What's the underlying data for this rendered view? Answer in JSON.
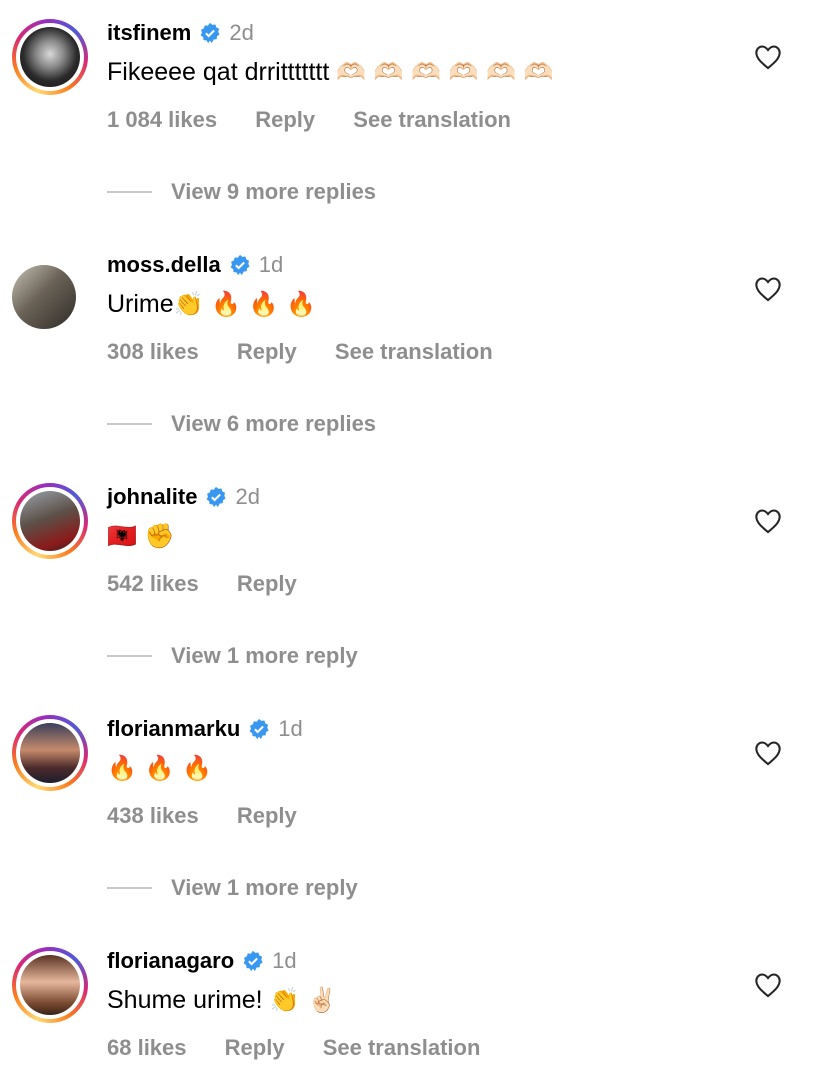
{
  "comments": [
    {
      "username": "itsfinem",
      "time": "2d",
      "text": "Fikeeee qat drrittttttt ",
      "emoji": "🫶🏻 🫶🏻 🫶🏻 🫶🏻 🫶🏻 🫶🏻",
      "likes": "1 084 likes",
      "reply": "Reply",
      "translate": "See translation",
      "view_more": "View 9 more replies",
      "story_ring": true
    },
    {
      "username": "moss.della",
      "time": "1d",
      "text": "Urime",
      "emoji": "👏 🔥 🔥 🔥",
      "likes": "308 likes",
      "reply": "Reply",
      "translate": "See translation",
      "view_more": "View 6 more replies",
      "story_ring": false
    },
    {
      "username": "johnalite",
      "time": "2d",
      "text": "",
      "emoji": "🇦🇱 ✊",
      "likes": "542 likes",
      "reply": "Reply",
      "translate": "",
      "view_more": "View 1 more reply",
      "story_ring": true
    },
    {
      "username": "florianmarku",
      "time": "1d",
      "text": "",
      "emoji": "🔥 🔥 🔥",
      "likes": "438 likes",
      "reply": "Reply",
      "translate": "",
      "view_more": "View 1 more reply",
      "story_ring": true
    },
    {
      "username": "florianagaro",
      "time": "1d",
      "text": "Shume urime! ",
      "emoji": "👏 ✌🏻",
      "likes": "68 likes",
      "reply": "Reply",
      "translate": "See translation",
      "view_more": "",
      "story_ring": true
    }
  ],
  "icons": {
    "verified": "verified-badge-icon",
    "like": "heart-outline-icon"
  },
  "colors": {
    "verified": "#3897f0",
    "secondary_text": "#8e8e8e"
  }
}
